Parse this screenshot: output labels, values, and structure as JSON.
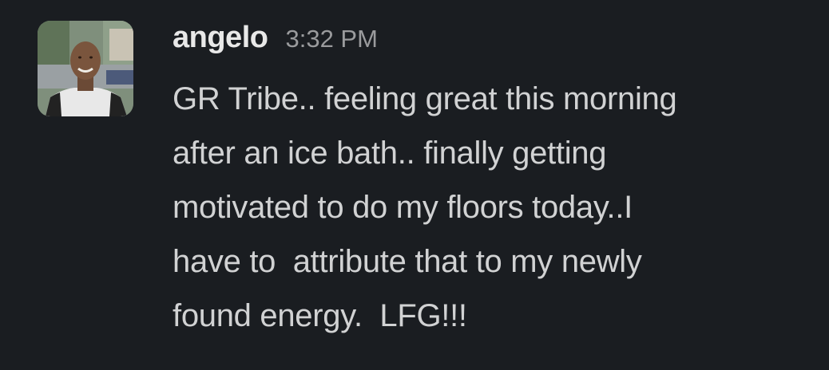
{
  "message": {
    "author": "angelo",
    "timestamp": "3:32 PM",
    "avatar_icon": "user-avatar-photo",
    "lines": [
      "GR Tribe.. feeling great this morning",
      "after an ice bath.. finally getting",
      "motivated to do my floors today..I",
      "have to  attribute that to my newly",
      "found energy.  LFG!!!"
    ]
  },
  "colors": {
    "background": "#1a1d21",
    "author": "#e8e8e8",
    "timestamp": "#9a9b9d",
    "text": "#d1d2d3"
  }
}
